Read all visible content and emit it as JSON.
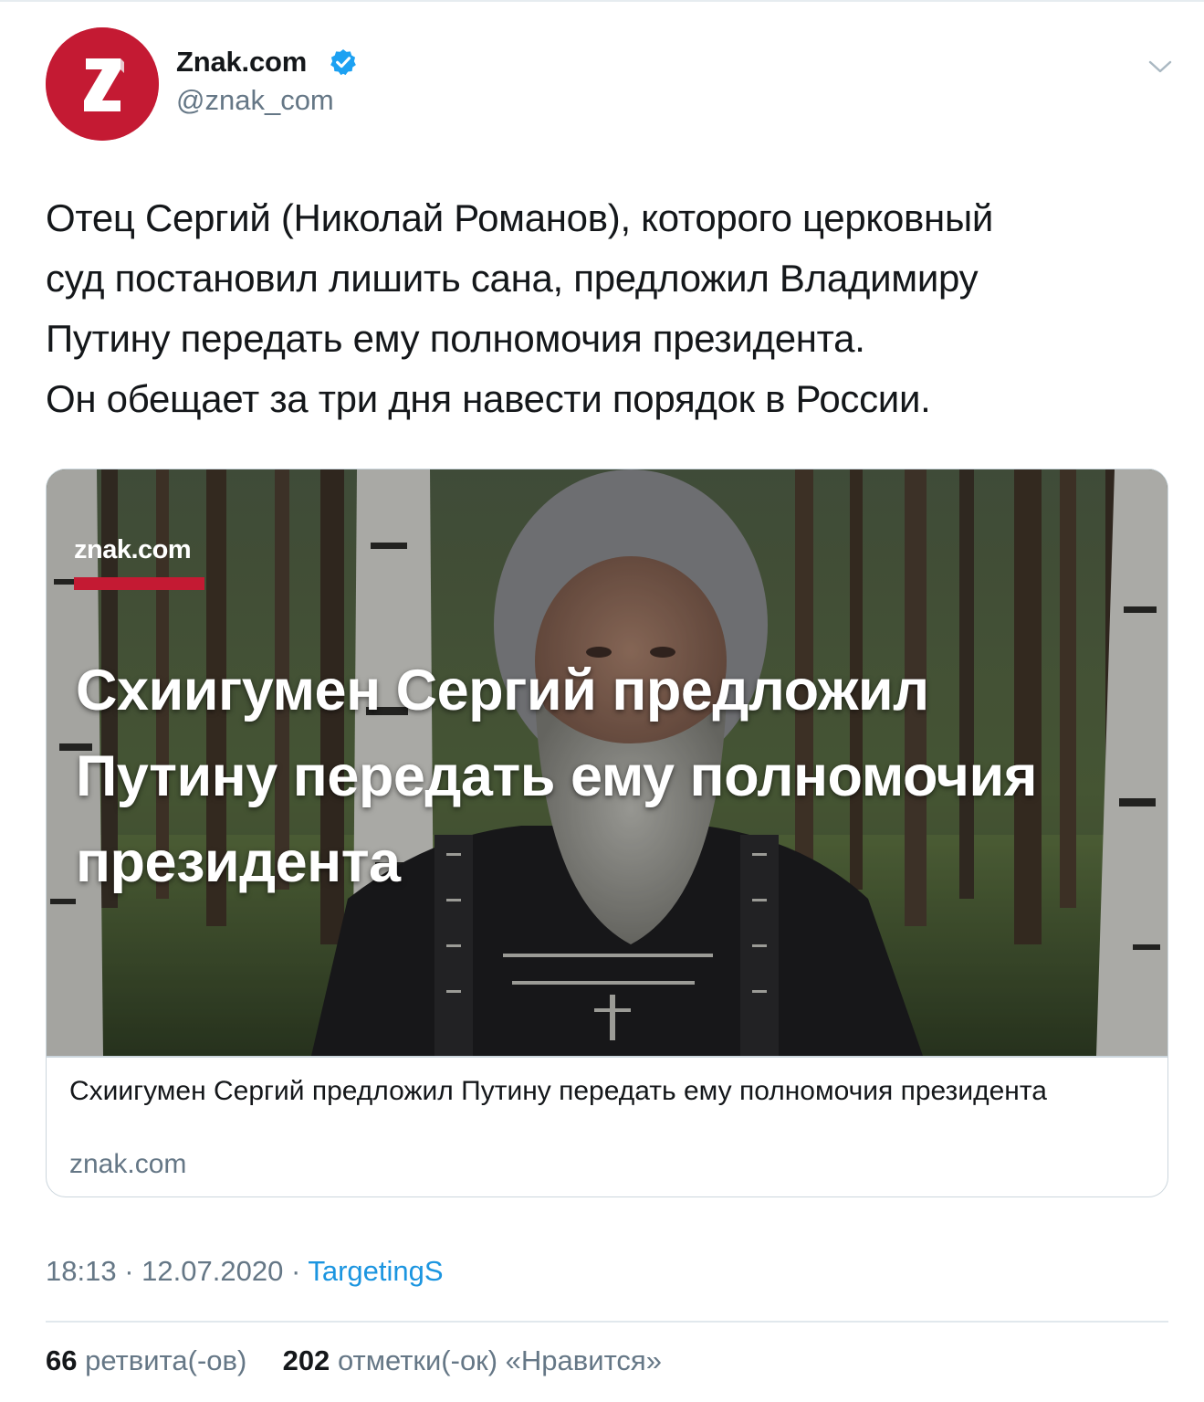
{
  "tweet": {
    "author": {
      "name": "Znak.com",
      "handle": "@znak_com",
      "avatar_letter": "Z",
      "avatar_color": "#c41a33",
      "verified": true
    },
    "text_lines": [
      "Отец Сергий (Николай Романов), которого церковный",
      "суд постановил лишить сана, предложил Владимиру",
      "Путину передать ему полномочия президента.",
      "Он обещает за три дня навести порядок в России."
    ],
    "card": {
      "image_logo": "znak.com",
      "image_headline_lines": [
        "Схиигумен Сергий предложил",
        "Путину передать ему полномочия",
        "президента"
      ],
      "title": "Схиигумен Сергий предложил Путину передать ему полномочия президента",
      "domain": "znak.com"
    },
    "time": "18:13",
    "date": "12.07.2020",
    "separator": "·",
    "source": "TargetingS",
    "stats": {
      "retweets_count": "66",
      "retweets_label": "ретвита(-ов)",
      "likes_count": "202",
      "likes_label": "отметки(-ок) «Нравится»"
    }
  },
  "colors": {
    "accent": "#1b95e0",
    "secondary_text": "#657786",
    "primary_text": "#14171a",
    "brand_red": "#c41a33"
  },
  "icons": {
    "verified": "verified-badge-icon",
    "menu": "chevron-down-icon"
  }
}
